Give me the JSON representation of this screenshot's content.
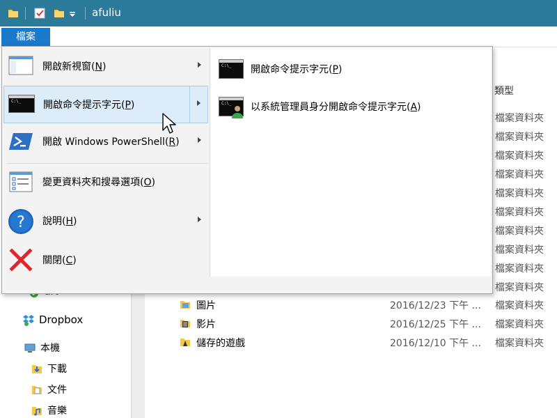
{
  "window": {
    "title": "afuliu"
  },
  "ribbon": {
    "file_tab": "檔案"
  },
  "file_menu": {
    "items": [
      {
        "label": "開啟新視窗(",
        "key": "N",
        "tail": ")",
        "has_submenu": true,
        "icon": "new-window-icon"
      },
      {
        "label": "開啟命令提示字元(",
        "key": "P",
        "tail": ")",
        "has_submenu": true,
        "icon": "command-prompt-icon",
        "highlighted": true
      },
      {
        "label": "開啟 Windows PowerShell(",
        "key": "R",
        "tail": ")",
        "has_submenu": true,
        "icon": "powershell-icon"
      },
      {
        "label": "變更資料夾和搜尋選項(",
        "key": "O",
        "tail": ")",
        "has_submenu": false,
        "icon": "folder-options-icon"
      },
      {
        "label": "說明(",
        "key": "H",
        "tail": ")",
        "has_submenu": true,
        "icon": "help-icon"
      },
      {
        "label": "關閉(",
        "key": "C",
        "tail": ")",
        "has_submenu": false,
        "icon": "close-icon"
      }
    ],
    "submenu": [
      {
        "label": "開啟命令提示字元(",
        "key": "P",
        "tail": ")",
        "icon": "command-prompt-icon"
      },
      {
        "label": "以系統管理員身分開啟命令提示字元(",
        "key": "A",
        "tail": ")",
        "icon": "admin-command-prompt-icon"
      }
    ]
  },
  "content": {
    "column_type": "類型",
    "type_values": [
      "檔案資料夾",
      "檔案資料夾",
      "檔案資料夾",
      "檔案資料夾",
      "檔案資料夾",
      "檔案資料夾",
      "檔案資料夾",
      "檔案資料夾",
      "檔案資料夾",
      "檔案資料夾"
    ],
    "rows": [
      {
        "name": "圖片",
        "date": "2016/12/23 下午 ...",
        "type": "檔案資料夾",
        "icon": "pictures-folder-icon"
      },
      {
        "name": "影片",
        "date": "2016/12/25 下午 ...",
        "type": "檔案資料夾",
        "icon": "videos-folder-icon"
      },
      {
        "name": "儲存的遊戲",
        "date": "2016/12/10 下午 ...",
        "type": "檔案資料夾",
        "icon": "saved-games-folder-icon"
      }
    ]
  },
  "nav": {
    "partial_item": "art",
    "items": [
      {
        "label": "Dropbox",
        "icon": "dropbox-icon"
      },
      {
        "label": "本機",
        "icon": "this-pc-icon"
      },
      {
        "label": "下載",
        "icon": "downloads-folder-icon"
      },
      {
        "label": "文件",
        "icon": "documents-folder-icon"
      },
      {
        "label": "音樂",
        "icon": "music-folder-icon"
      }
    ]
  },
  "colors": {
    "titlebar": "#2b7a99",
    "file_tab": "#1979ca",
    "highlight": "#dcecf8"
  }
}
